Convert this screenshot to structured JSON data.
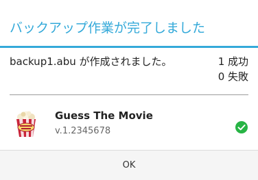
{
  "dialog": {
    "title": "バックアップ作業が完了しました",
    "message": "backup1.abu が作成されました。",
    "success_count": "1 成功",
    "failure_count": "0 失敗",
    "app": {
      "name": "Guess The Movie",
      "version": "v.1.2345678",
      "icon": "popcorn-app-icon",
      "status_icon": "check-circle-icon"
    },
    "ok_label": "OK"
  },
  "colors": {
    "accent": "#33a9d9",
    "success": "#27b445"
  }
}
